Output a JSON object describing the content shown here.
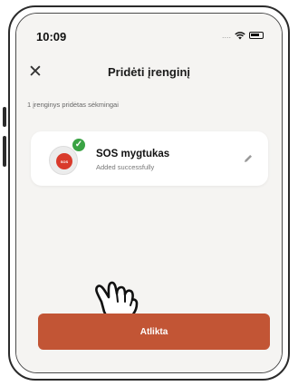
{
  "status_bar": {
    "time": "10:09",
    "signal_dots": "....",
    "icons": [
      "wifi-icon",
      "battery-icon"
    ]
  },
  "header": {
    "title": "Pridėti įrenginį",
    "close_icon": "close-icon"
  },
  "main": {
    "subtitle": "1 įrenginys pridėtas sėkmingai",
    "device": {
      "name": "SOS mygtukas",
      "status": "Added successfully",
      "badge_text": "SOS",
      "icon": "sos-button-icon",
      "status_icon": "check-icon",
      "edit_icon": "pencil-icon"
    },
    "done_button": "Atlikta"
  },
  "colors": {
    "accent": "#c25535",
    "success": "#3aa344",
    "sos_red": "#d93a2b",
    "background": "#f5f4f2"
  }
}
